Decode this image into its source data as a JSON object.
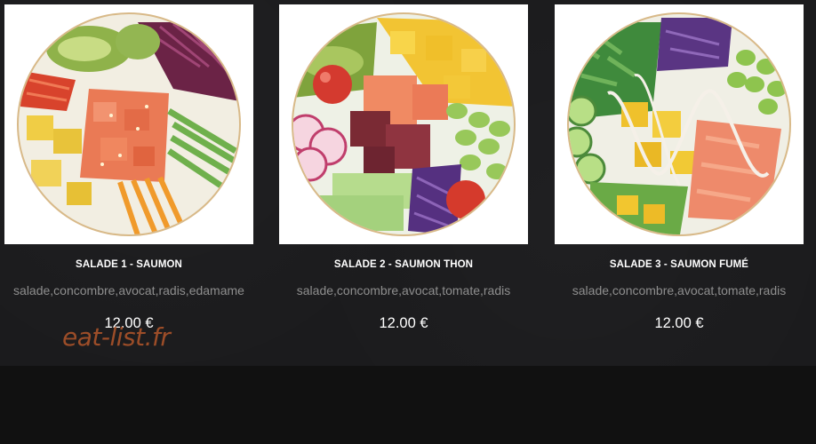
{
  "menu": {
    "items": [
      {
        "name": "SALADE 1 - SAUMON",
        "ingredients": "salade,concombre,avocat,radis,edamame",
        "price": "12.00 €",
        "image_alt": "salmon poke bowl"
      },
      {
        "name": "SALADE 2 - SAUMON THON",
        "ingredients": "salade,concombre,avocat,tomate,radis",
        "price": "12.00 €",
        "image_alt": "salmon and tuna poke bowl"
      },
      {
        "name": "SALADE 3 - SAUMON FUMÉ",
        "ingredients": "salade,concombre,avocat,tomate,radis",
        "price": "12.00 €",
        "image_alt": "smoked salmon poke bowl"
      }
    ]
  },
  "watermark": "eat-list.fr",
  "colors": {
    "page_bg": "#1b1b1d",
    "name_text": "#ffffff",
    "ingredients_text": "#8e8e8e",
    "price_text": "#ffffff",
    "watermark": "#b3562a",
    "bowl_rim": "#c9a56a"
  }
}
